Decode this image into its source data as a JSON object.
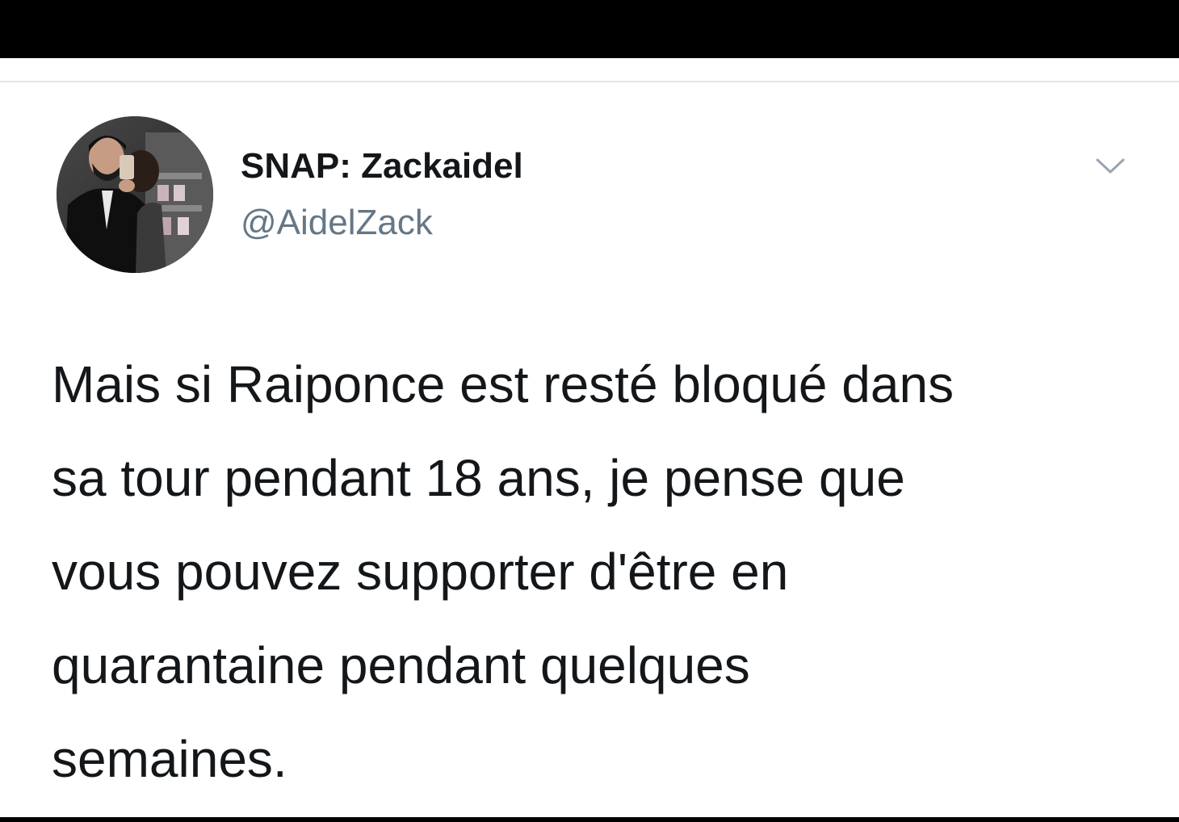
{
  "tweet": {
    "author": {
      "display_name": "SNAP: Zackaidel",
      "handle": "@AidelZack",
      "avatar_icon": "profile-photo"
    },
    "menu_icon": "chevron-down-icon",
    "text_lines": [
      "Mais si Raiponce est resté bloqué dans",
      "sa tour pendant 18 ans, je pense que",
      "vous pouvez supporter d'être en",
      "quarantaine pendant quelques",
      "semaines."
    ]
  },
  "colors": {
    "name": "#14171a",
    "handle": "#657786",
    "text": "#14171a",
    "divider": "#e6e6e6",
    "chevron": "#9aa5b1"
  }
}
